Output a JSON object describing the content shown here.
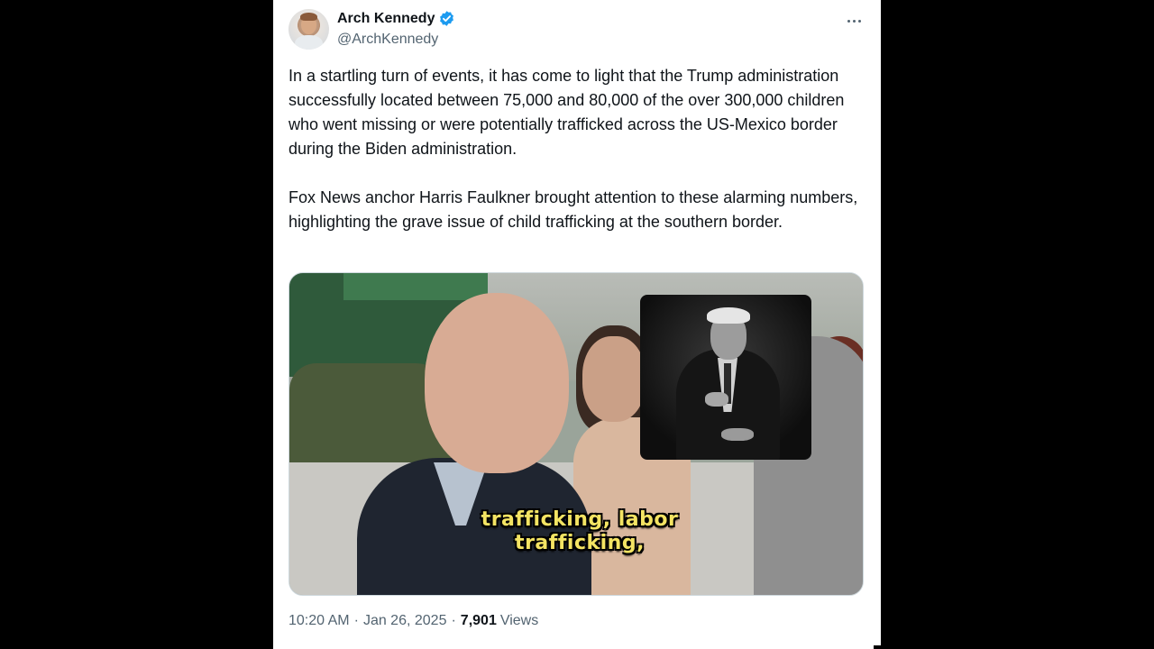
{
  "author": {
    "display_name": "Arch Kennedy",
    "handle": "@ArchKennedy",
    "verified": true
  },
  "tweet": {
    "paragraphs": [
      "In a startling turn of events, it has come to light that the Trump administration successfully located between 75,000 and 80,000 of the over 300,000 children who went missing or were potentially trafficked across the US-Mexico border during the Biden administration.",
      "Fox News anchor Harris Faulkner brought attention to these alarming numbers, highlighting the grave issue of child trafficking at the southern border."
    ]
  },
  "media": {
    "caption_lines": [
      "trafficking, labor",
      "trafficking,"
    ]
  },
  "meta": {
    "time": "10:20 AM",
    "separator": "·",
    "date": "Jan 26, 2025",
    "views_count": "7,901",
    "views_label": "Views"
  },
  "icons": {
    "verified": "verified-badge-icon",
    "more": "more-options-icon"
  },
  "colors": {
    "verified_blue": "#1d9bf0",
    "text_primary": "#0f1419",
    "text_secondary": "#536471",
    "caption_yellow": "#f4e463"
  }
}
